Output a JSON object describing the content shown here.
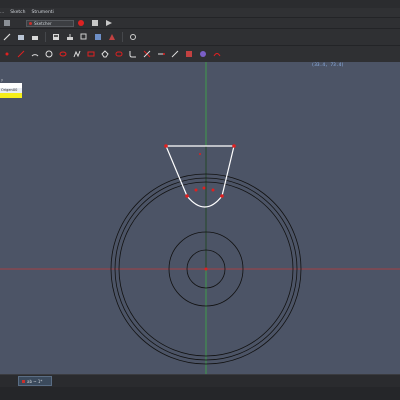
{
  "menubar": {
    "items": [
      "...",
      "Sketch",
      "Strumenti"
    ]
  },
  "toolbar": {
    "workbench": "Sketcher",
    "buttons_row1": [
      "record-icon",
      "stop-icon",
      "play-icon"
    ],
    "buttons_row2": [
      "pen-icon",
      "open-icon",
      "folder-icon",
      "save-icon",
      "export-icon",
      "copy-icon",
      "grid-icon",
      "shape-icon",
      "settings-icon"
    ],
    "buttons_row3": [
      "point-icon",
      "line-icon",
      "arc-icon",
      "circle-icon",
      "conic-icon",
      "polyline-icon",
      "rectangle-icon",
      "polygon-icon",
      "slot-icon",
      "fillet-icon",
      "trim-icon",
      "extend-icon",
      "split-icon",
      "external-icon",
      "construction-icon",
      "constraint-icon"
    ]
  },
  "viewport": {
    "coords": "(33.4, 73.4)",
    "tree": [
      "y",
      "",
      "OrigenX0",
      ""
    ]
  },
  "statusbar": {
    "doc_tab": "ab ~ 1*"
  },
  "colors": {
    "viewport_bg": "#4c5466",
    "axis_x": "#c03a3a",
    "axis_y": "#3cae45",
    "geometry": "#111111",
    "sketch": "#ffffff",
    "point": "#e02020"
  }
}
